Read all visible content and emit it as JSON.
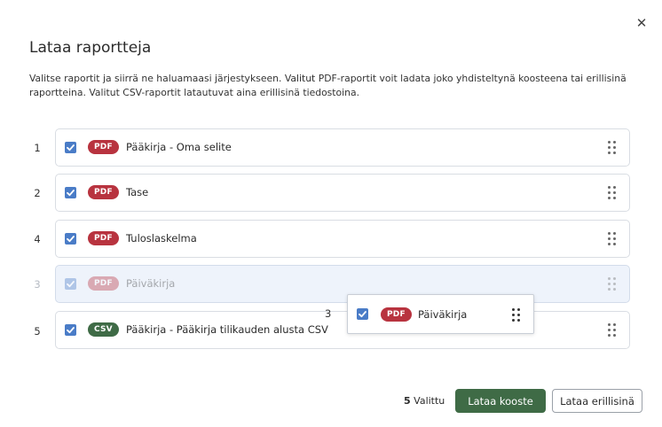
{
  "dialog": {
    "close_glyph": "✕",
    "title": "Lataa raportteja",
    "description": "Valitse raportit ja siirrä ne haluamaasi järjestykseen. Valitut PDF-raportit voit ladata joko yhdisteltynä koosteena tai erillisinä raportteina. Valitut CSV-raportit latautuvat aina erillisinä tiedostoina."
  },
  "reports": [
    {
      "order": "1",
      "type": "PDF",
      "name": "Pääkirja - Oma selite",
      "checked": true
    },
    {
      "order": "2",
      "type": "PDF",
      "name": "Tase",
      "checked": true
    },
    {
      "order": "4",
      "type": "PDF",
      "name": "Tuloslaskelma",
      "checked": true
    },
    {
      "order": "3",
      "type": "PDF",
      "name": "Päiväkirja",
      "checked": true,
      "placeholder": true
    },
    {
      "order": "5",
      "type": "CSV",
      "name": "Pääkirja - Pääkirja tilikauden alusta CSV",
      "checked": true
    }
  ],
  "dragging": {
    "order": "3",
    "type": "PDF",
    "name": "Päiväkirja",
    "checked": true
  },
  "footer": {
    "selected_count": "5",
    "selected_label": "Valittu",
    "download_combined": "Lataa kooste",
    "download_separate": "Lataa erillisinä"
  },
  "colors": {
    "pdf_badge": "#b8333f",
    "csv_badge": "#3f6b46",
    "checkbox": "#4a7cc7",
    "primary_button": "#3f6b46",
    "placeholder_bg": "#eef3fb"
  },
  "icons": {
    "close": "close-icon",
    "checkbox": "checkmark-icon",
    "grip": "drag-handle-icon"
  }
}
